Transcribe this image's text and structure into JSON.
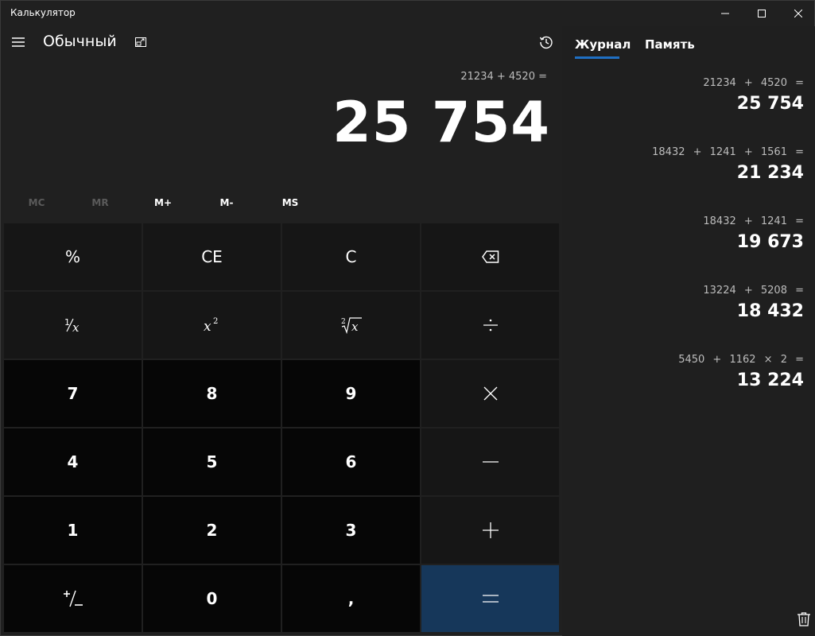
{
  "window": {
    "title": "Калькулятор"
  },
  "header": {
    "mode": "Обычный"
  },
  "display": {
    "expression": "21234 + 4520 =",
    "result": "25 754"
  },
  "memory": {
    "mc": "MC",
    "mr": "MR",
    "mplus": "M+",
    "mminus": "M-",
    "ms": "MS"
  },
  "keys": {
    "percent": "%",
    "ce": "CE",
    "c": "C",
    "seven": "7",
    "eight": "8",
    "nine": "9",
    "four": "4",
    "five": "5",
    "six": "6",
    "one": "1",
    "two": "2",
    "three": "3",
    "zero": "0",
    "comma": ","
  },
  "panel": {
    "tab_journal": "Журнал",
    "tab_memory": "Память",
    "history": [
      {
        "expr": "21234 + 4520 =",
        "value": "25 754"
      },
      {
        "expr": "18432 + 1241 + 1561 =",
        "value": "21 234"
      },
      {
        "expr": "18432 + 1241 =",
        "value": "19 673"
      },
      {
        "expr": "13224 + 5208 =",
        "value": "18 432"
      },
      {
        "expr": "5450 + 1162 × 2 =",
        "value": "13 224"
      }
    ]
  },
  "colors": {
    "accent": "#1f6fc3",
    "equals": "#16375a",
    "background": "#202020"
  },
  "icons": {
    "menu": "hamburger-icon",
    "keep_on_top": "keep-on-top-icon",
    "history": "history-icon",
    "minimize": "minimize-icon",
    "maximize": "maximize-icon",
    "close": "close-icon",
    "backspace": "backspace-icon",
    "divide": "divide-icon",
    "multiply": "multiply-icon",
    "minus": "minus-icon",
    "plus": "plus-icon",
    "equals": "equals-icon",
    "trash": "trash-icon"
  }
}
